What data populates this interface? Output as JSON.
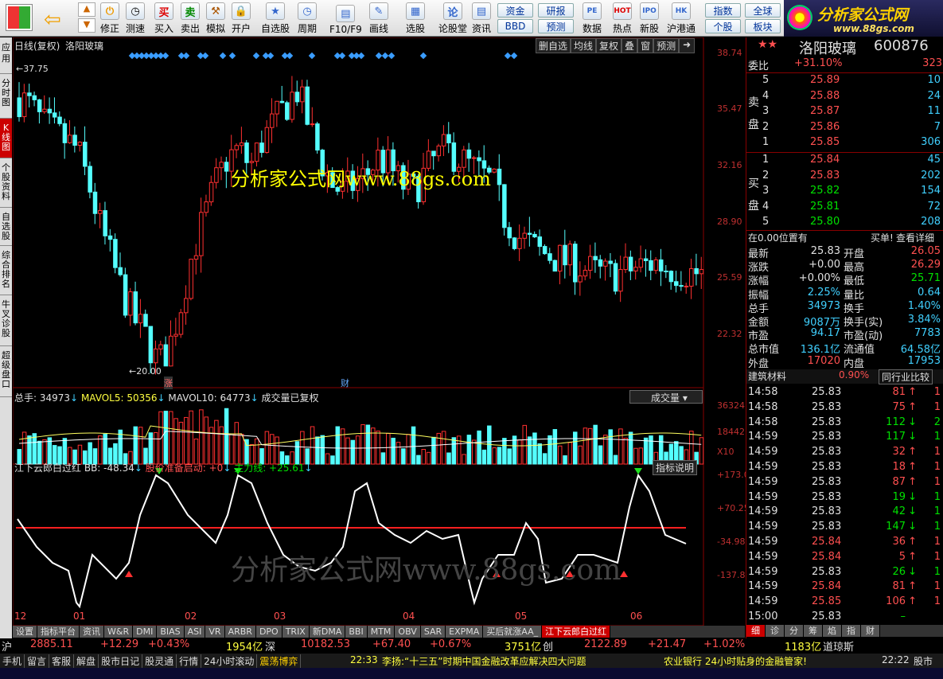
{
  "toolbar": {
    "items": [
      "买入",
      "卖出",
      "模拟",
      "开户",
      "自选股",
      "周期",
      "F10/F9",
      "画线",
      "选股",
      "论股堂",
      "资讯",
      "数据",
      "热点",
      "新股",
      "沪港通"
    ],
    "nav_items": [
      "修正",
      "测速"
    ],
    "small": [
      "资金",
      "研报",
      "BBD",
      "预测",
      "指数",
      "全球",
      "个股",
      "板块"
    ],
    "brand": "分析家公式网",
    "brand_url": "www.88gs.com"
  },
  "leftnav": [
    "应用",
    "分时图",
    "K线图",
    "个股资料",
    "自选股",
    "综合排名",
    "牛叉诊股",
    "超级盘口"
  ],
  "chart": {
    "title": "日线(复权)",
    "stock": "洛阳玻璃",
    "buttons": [
      "删自选",
      "均线",
      "复权",
      "叠",
      "窗",
      "预测"
    ],
    "price_axis": [
      "38.74",
      "35.47",
      "32.16",
      "28.90",
      "25.59",
      "22.32"
    ],
    "high_label": "37.75",
    "low_label": "20.00",
    "watermark": "分析家公式网www.88gs.com",
    "event1": "涨",
    "event2": "财",
    "vol_legend": {
      "total": "总手: 34973",
      "ma5": "MAVOL5: 50356",
      "ma10": "MAVOL10: 64773",
      "note": "成交量已复权",
      "name": "成交量"
    },
    "vol_axis": [
      "36324",
      "18442",
      "X10"
    ],
    "ind_legend": {
      "name": "江下云郎白过红",
      "bb": "BB: -48.34",
      "warn": "股价准备启动: +0",
      "main": "主力线: +25.61",
      "help": "指标说明"
    },
    "ind_axis": [
      "+173.0",
      "+70.25",
      "-34.98",
      "-137.8"
    ],
    "ind_labels": [
      "始",
      "终"
    ],
    "months": [
      "12",
      "01",
      "02",
      "03",
      "04",
      "05",
      "06"
    ],
    "watermark2": "分析家公式网www.88gs.com"
  },
  "chart_data": {
    "type": "candlestick",
    "symbol": "洛阳玻璃",
    "ylim": [
      20.0,
      38.74
    ],
    "y_ticks": [
      38.74,
      35.47,
      32.16,
      28.9,
      25.59,
      22.32
    ],
    "annotations": {
      "high": 37.75,
      "low": 20.0
    },
    "x_months": [
      "12",
      "01",
      "02",
      "03",
      "04",
      "05",
      "06"
    ]
  },
  "quote": {
    "code": "600876",
    "name": "洛阳玻璃",
    "wb_label": "委比",
    "wb": "+31.10%",
    "wb_vol": "323",
    "sell_label": "卖盘",
    "buy_label": "买盘",
    "sell": [
      [
        "5",
        "25.89",
        "10"
      ],
      [
        "4",
        "25.88",
        "24"
      ],
      [
        "3",
        "25.87",
        "11"
      ],
      [
        "2",
        "25.86",
        "7"
      ],
      [
        "1",
        "25.85",
        "306"
      ]
    ],
    "buy": [
      [
        "1",
        "25.84",
        "45"
      ],
      [
        "2",
        "25.83",
        "202"
      ],
      [
        "3",
        "25.82",
        "154"
      ],
      [
        "4",
        "25.81",
        "72"
      ],
      [
        "5",
        "25.80",
        "208"
      ]
    ],
    "pos": "在0.00位置有",
    "buyone": "买单!",
    "detail": "查看详细",
    "stats": [
      [
        "最新",
        "25.83",
        "开盘",
        "26.05"
      ],
      [
        "涨跌",
        "+0.00",
        "最高",
        "26.29"
      ],
      [
        "涨幅",
        "+0.00%",
        "最低",
        "25.71"
      ],
      [
        "振幅",
        "2.25%",
        "量比",
        "0.64"
      ],
      [
        "总手",
        "34973",
        "换手",
        "1.40%"
      ],
      [
        "金额",
        "9087万",
        "换手(实)",
        "3.84%"
      ],
      [
        "市盈",
        "94.17",
        "市盈(动)",
        "7783"
      ],
      [
        "总市值",
        "136.1亿",
        "流通值",
        "64.58亿"
      ],
      [
        "外盘",
        "17020",
        "内盘",
        "17953"
      ]
    ],
    "sector": "建筑材料",
    "sector_pct": "0.90%",
    "sector_btn": "同行业比较",
    "ticks": [
      [
        "14:58",
        "25.83",
        "81",
        "↑",
        "1"
      ],
      [
        "14:58",
        "25.83",
        "75",
        "↑",
        "1"
      ],
      [
        "14:58",
        "25.83",
        "112",
        "↓",
        "2"
      ],
      [
        "14:59",
        "25.83",
        "117",
        "↓",
        "1"
      ],
      [
        "14:59",
        "25.83",
        "32",
        "↑",
        "1"
      ],
      [
        "14:59",
        "25.83",
        "18",
        "↑",
        "1"
      ],
      [
        "14:59",
        "25.83",
        "87",
        "↑",
        "1"
      ],
      [
        "14:59",
        "25.83",
        "19",
        "↓",
        "1"
      ],
      [
        "14:59",
        "25.83",
        "42",
        "↓",
        "1"
      ],
      [
        "14:59",
        "25.83",
        "147",
        "↓",
        "1"
      ],
      [
        "14:59",
        "25.84",
        "36",
        "↑",
        "1"
      ],
      [
        "14:59",
        "25.84",
        "5",
        "↑",
        "1"
      ],
      [
        "14:59",
        "25.83",
        "26",
        "↓",
        "1"
      ],
      [
        "14:59",
        "25.84",
        "81",
        "↑",
        "1"
      ],
      [
        "14:59",
        "25.85",
        "106",
        "↑",
        "1"
      ],
      [
        "15:00",
        "25.83",
        "–",
        "",
        ""
      ]
    ],
    "rtabs": [
      "细",
      "诊",
      "分",
      "筹",
      "焰",
      "指",
      "财"
    ]
  },
  "tabs": [
    "设置",
    "指标平台",
    "资讯",
    "W&R",
    "DMI",
    "BIAS",
    "ASI",
    "VR",
    "ARBR",
    "DPO",
    "TRIX",
    "新DMA",
    "BBI",
    "MTM",
    "OBV",
    "SAR",
    "EXPMA",
    "买后就涨AA_",
    "江下云郎白过红"
  ],
  "index": {
    "sh_label": "沪",
    "sh": "2885.11",
    "sh_chg": "+12.29",
    "sh_pct": "+0.43%",
    "sh_amt": "1954亿",
    "sz_label": "深",
    "sz": "10182.53",
    "sz_chg": "+67.40",
    "sz_pct": "+0.67%",
    "sz_amt": "3751亿",
    "cy_label": "创",
    "cy": "2122.89",
    "cy_chg": "+21.47",
    "cy_pct": "+1.02%",
    "dj_amt": "1183亿",
    "dj_label": "道琼斯"
  },
  "news": {
    "left": [
      "手机",
      "留言",
      "客服",
      "解盘",
      "股市日记",
      "股灵通",
      "行情",
      "24小时滚动",
      "震荡博弈"
    ],
    "time": "22:33",
    "headline": "李扬:“十三五”时期中国金融改革应解决四大问题",
    "ad": "农业银行 24小时贴身的金融管家!",
    "clock": "22:22",
    "tail": "股市"
  }
}
